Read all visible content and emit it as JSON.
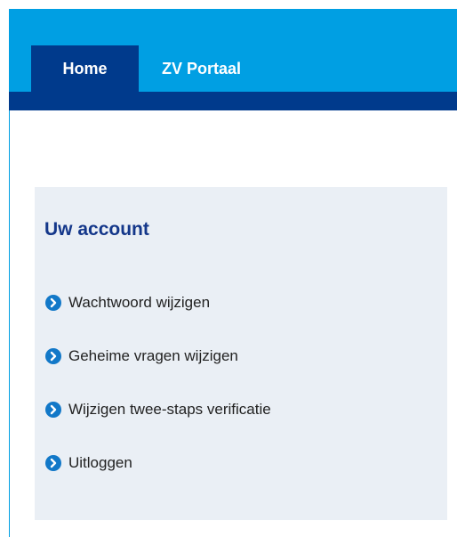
{
  "nav": {
    "tabs": [
      {
        "label": "Home",
        "active": true
      },
      {
        "label": "ZV Portaal",
        "active": false
      }
    ]
  },
  "account": {
    "title": "Uw account",
    "links": [
      {
        "label": "Wachtwoord wijzigen",
        "icon": "chevron-right-circle-icon"
      },
      {
        "label": "Geheime vragen wijzigen",
        "icon": "chevron-right-circle-icon"
      },
      {
        "label": "Wijzigen twee-staps verificatie",
        "icon": "chevron-right-circle-icon"
      },
      {
        "label": "Uitloggen",
        "icon": "chevron-right-circle-icon"
      }
    ]
  },
  "colors": {
    "header_blue": "#009fe3",
    "nav_dark_blue": "#003a8c",
    "panel_bg": "#eaeff5",
    "title_blue": "#14378a",
    "icon_blue": "#1278c8"
  }
}
